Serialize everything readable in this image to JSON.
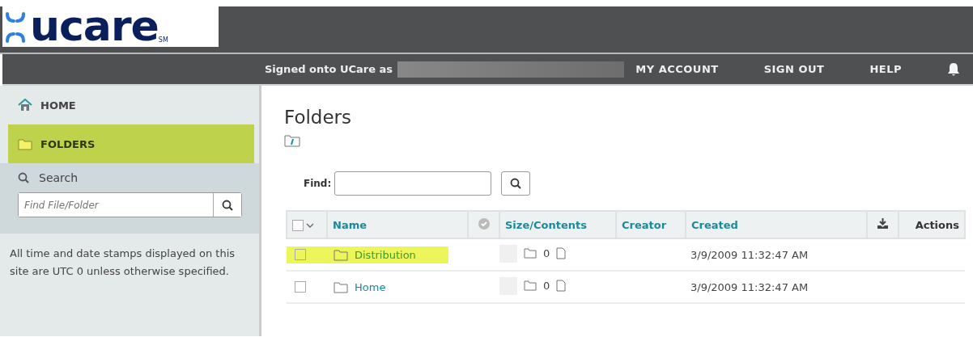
{
  "logo": {
    "text": "ucare",
    "mark": "SM"
  },
  "topnav": {
    "signed_in": "Signed onto UCare as",
    "links": [
      "MY ACCOUNT",
      "SIGN OUT",
      "HELP"
    ]
  },
  "sidebar": {
    "items": [
      {
        "label": "HOME",
        "kind": "home",
        "selected": false
      },
      {
        "label": "FOLDERS",
        "kind": "folder",
        "selected": true
      }
    ],
    "search": {
      "label": "Search",
      "placeholder": "Find File/Folder"
    },
    "note": "All time and date stamps displayed on this site are UTC 0 unless otherwise specified."
  },
  "main": {
    "title": "Folders",
    "find_label": "Find:",
    "table": {
      "select_all_checked": false,
      "columns": [
        "Name",
        "Size/Contents",
        "Creator",
        "Created",
        "Actions"
      ],
      "rows": [
        {
          "name": "Distribution",
          "checked": false,
          "highlighted": true,
          "count": "0",
          "created": "3/9/2009 11:32:47 AM"
        },
        {
          "name": "Home",
          "checked": false,
          "highlighted": false,
          "count": "0",
          "created": "3/9/2009 11:32:47 AM"
        }
      ]
    }
  }
}
